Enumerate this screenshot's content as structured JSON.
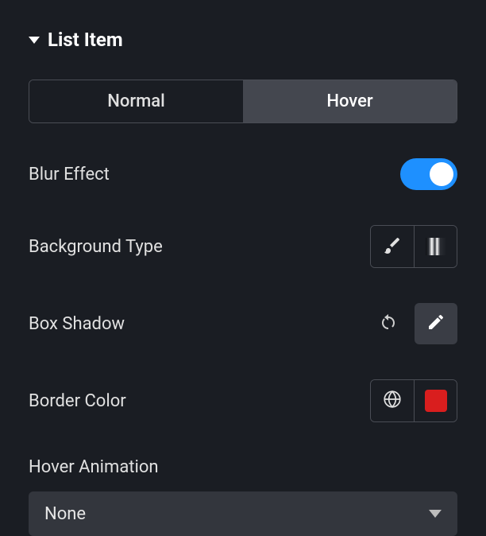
{
  "section": {
    "title": "List Item"
  },
  "tabs": {
    "normal": "Normal",
    "hover": "Hover",
    "active": "hover"
  },
  "blur_effect": {
    "label": "Blur Effect",
    "enabled": true
  },
  "background_type": {
    "label": "Background Type",
    "options": [
      "classic",
      "gradient"
    ]
  },
  "box_shadow": {
    "label": "Box Shadow"
  },
  "border_color": {
    "label": "Border Color",
    "value": "#d91e1e"
  },
  "hover_animation": {
    "label": "Hover Animation",
    "selected": "None"
  }
}
